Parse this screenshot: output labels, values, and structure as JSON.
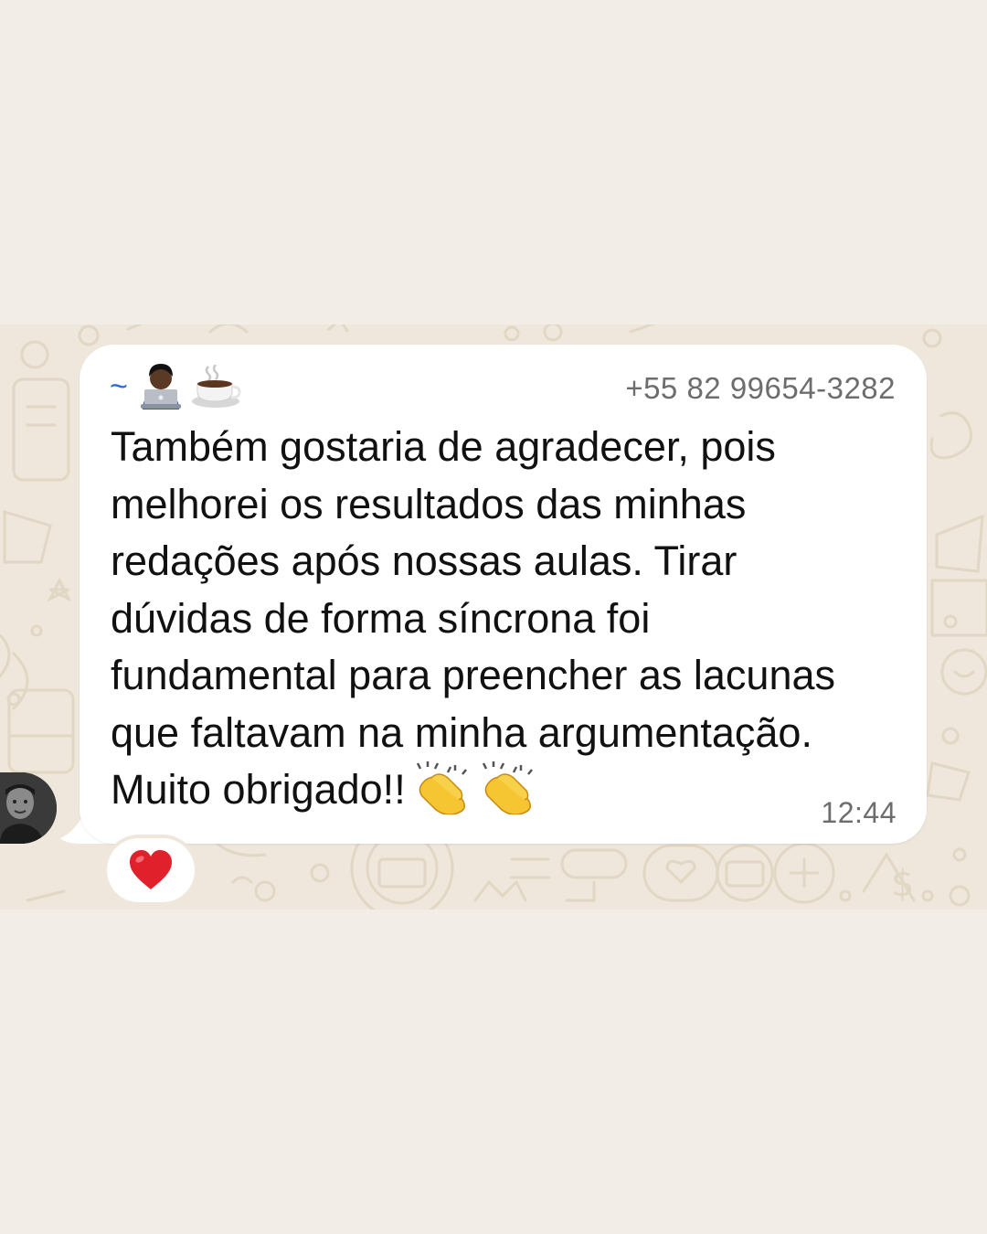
{
  "chat": {
    "sender_prefix": "~",
    "sender_emoji_icons": [
      "technologist-icon",
      "coffee-icon"
    ],
    "phone": "+55 82 99654-3282",
    "message_lines": [
      "Também gostaria de agradecer, pois",
      "melhorei os resultados das minhas",
      "redações após nossas aulas. Tirar",
      "dúvidas de forma síncrona foi",
      "fundamental para preencher as lacunas",
      "que faltavam na minha argumentação.",
      "Muito obrigado!!"
    ],
    "message_end_emoji_icons": [
      "clapping-hands-icon",
      "clapping-hands-icon"
    ],
    "time": "12:44",
    "reaction_icon": "red-heart-icon"
  },
  "colors": {
    "page_background": "#f2ede6",
    "chat_background": "#efe7dc",
    "bubble": "#ffffff",
    "sender_accent": "#2a6ad9",
    "meta_text": "#6d6d6d",
    "reaction_heart": "#e0202b"
  }
}
